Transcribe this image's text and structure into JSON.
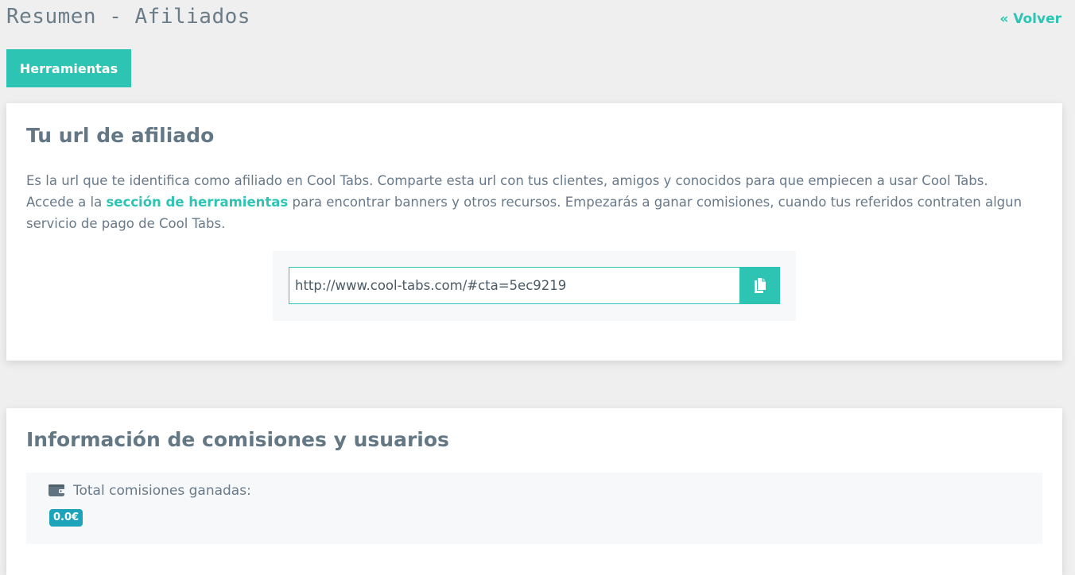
{
  "header": {
    "title": "Resumen - Afiliados",
    "back_label": "« Volver"
  },
  "toolbar": {
    "tools_label": "Herramientas"
  },
  "affiliate_url_card": {
    "title": "Tu url de afiliado",
    "description_part1": "Es la url que te identifica como afiliado en Cool Tabs. Comparte esta url con tus clientes, amigos y conocidos para que empiecen a usar Cool Tabs. Accede a la ",
    "tools_link_label": "sección de herramientas",
    "description_part2": " para encontrar banners y otros recursos. Empezarás a ganar comisiones, cuando tus referidos contraten algun servicio de pago de Cool Tabs.",
    "url_value": "http://www.cool-tabs.com/#cta=5ec9219",
    "copy_icon": "copy-icon"
  },
  "info_card": {
    "title": "Información de comisiones y usuarios",
    "wallet_icon": "wallet-icon",
    "total_label": "Total comisiones ganadas:",
    "total_value": "0.0€"
  },
  "colors": {
    "accent": "#2ec4b4",
    "badge": "#1da4bb",
    "background": "#efefef"
  }
}
